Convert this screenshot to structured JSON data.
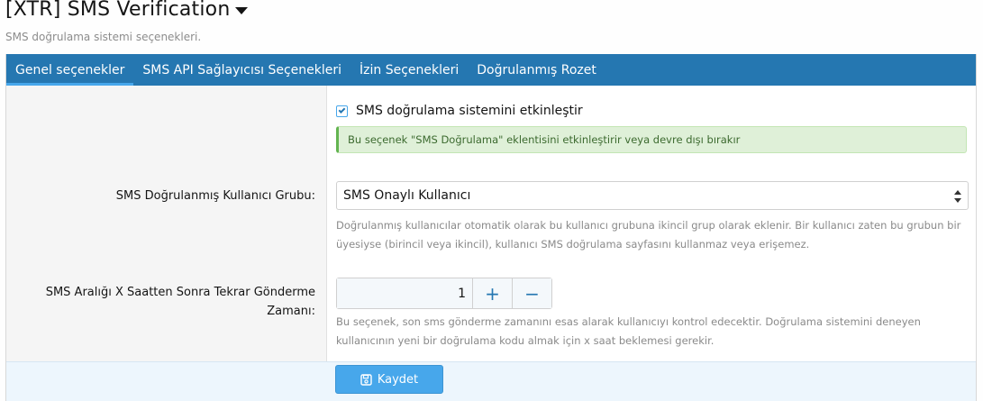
{
  "header": {
    "title": "[XTR] SMS Verification",
    "subtitle": "SMS doğrulama sistemi seçenekleri."
  },
  "tabs": [
    {
      "label": "Genel seçenekler",
      "active": true
    },
    {
      "label": "SMS API Sağlayıcısı Seçenekleri",
      "active": false
    },
    {
      "label": "İzin Seçenekleri",
      "active": false
    },
    {
      "label": "Doğrulanmış Rozet",
      "active": false
    }
  ],
  "options": {
    "enable": {
      "label": "SMS doğrulama sistemini etkinleştir",
      "checked": true,
      "hint": "Bu seçenek \"SMS Doğrulama\" eklentisini etkinleştirir veya devre dışı bırakır"
    },
    "group": {
      "label": "SMS Doğrulanmış Kullanıcı Grubu:",
      "selected": "SMS Onaylı Kullanıcı",
      "explain_line1": "Doğrulanmış kullanıcılar otomatik olarak bu kullanıcı grubuna ikincil grup olarak eklenir. Bir kullanıcı zaten bu grubun bir",
      "explain_line2": "üyesiyse (birincil veya ikincil), kullanıcı SMS doğrulama sayfasını kullanmaz veya erişemez."
    },
    "resend": {
      "label_line1": "SMS Aralığı X Saatten Sonra Tekrar Gönderme",
      "label_line2": "Zamanı:",
      "value": "1",
      "plus": "+",
      "minus": "−",
      "explain_line1": "Bu seçenek, son sms gönderme zamanını esas alarak kullanıcıyı kontrol edecektir. Doğrulama sistemini deneyen",
      "explain_line2": "kullanıcının yeni bir doğrulama kodu almak için x saat beklemesi gerekir."
    }
  },
  "footer": {
    "save_label": "Kaydet"
  },
  "colors": {
    "accent": "#2577b1",
    "button": "#47a7eb",
    "success_bg": "#dff0d8"
  },
  "icons": {
    "title_caret": "caret-down-icon",
    "checkbox": "check-icon",
    "select": "select-arrows-icon",
    "save": "floppy-disk-icon"
  }
}
